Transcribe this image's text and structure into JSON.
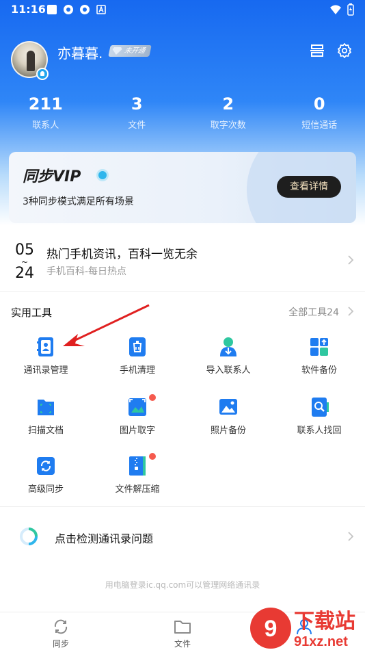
{
  "status_bar": {
    "time": "11:16"
  },
  "profile": {
    "username": "亦暮暮.",
    "vip_status": "未开通"
  },
  "stats": [
    {
      "value": "211",
      "label": "联系人"
    },
    {
      "value": "3",
      "label": "文件"
    },
    {
      "value": "2",
      "label": "取字次数"
    },
    {
      "value": "0",
      "label": "短信通话"
    }
  ],
  "vip_card": {
    "title": "同步VIP",
    "subtitle": "3种同步模式满足所有场景",
    "button": "查看详情"
  },
  "news": {
    "date_top": "05",
    "date_bottom": "24",
    "title": "热门手机资讯，百科一览无余",
    "subtitle": "手机百科-每日热点"
  },
  "tools_section": {
    "title": "实用工具",
    "all_tools": "全部工具24",
    "items": [
      {
        "label": "通讯录管理",
        "icon": "address-book-icon"
      },
      {
        "label": "手机清理",
        "icon": "phone-clean-icon"
      },
      {
        "label": "导入联系人",
        "icon": "import-contact-icon"
      },
      {
        "label": "软件备份",
        "icon": "app-backup-icon"
      },
      {
        "label": "扫描文档",
        "icon": "scan-document-icon"
      },
      {
        "label": "图片取字",
        "icon": "image-text-icon"
      },
      {
        "label": "照片备份",
        "icon": "photo-backup-icon"
      },
      {
        "label": "联系人找回",
        "icon": "contact-recover-icon"
      },
      {
        "label": "高级同步",
        "icon": "advanced-sync-icon"
      },
      {
        "label": "文件解压缩",
        "icon": "file-unzip-icon"
      }
    ]
  },
  "detect": {
    "label": "点击检测通讯录问题"
  },
  "footer_note": "用电脑登录ic.qq.com可以管理网络通讯录",
  "tabs": [
    {
      "label": "同步",
      "icon": "sync-icon"
    },
    {
      "label": "文件",
      "icon": "folder-icon"
    },
    {
      "label": "",
      "icon": "profile-icon"
    }
  ],
  "watermark": {
    "text_top": "下载站",
    "text_bottom": "91xz.net"
  },
  "colors": {
    "primary_blue": "#1769f0",
    "accent_red": "#f55a4e",
    "vip_button": "#1e1e1e"
  }
}
